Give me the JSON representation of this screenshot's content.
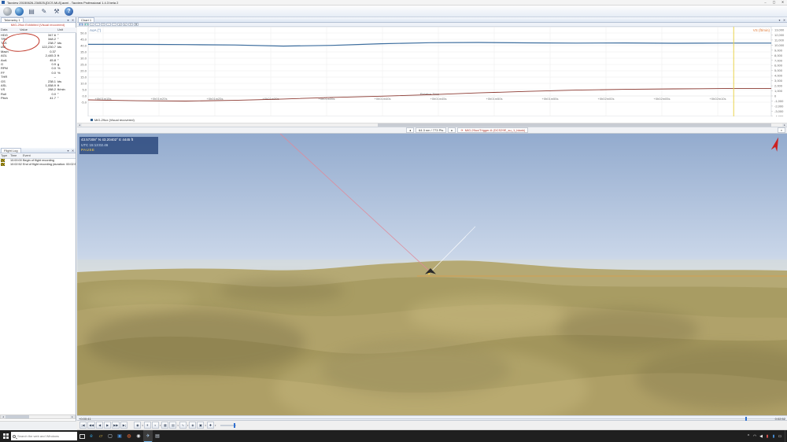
{
  "window": {
    "title": "Tacview 20150626-234525-[DCS.Mi-8].acmi - Tacview Professional 1.4.3 beta 2",
    "minimize": "–",
    "maximize": "▢",
    "close": "✕"
  },
  "panel_icons": {
    "pin": "▾",
    "close": "✕"
  },
  "toolbar": {
    "buttons": [
      {
        "name": "open-flight-button",
        "style": "globe-gray",
        "glyph": ""
      },
      {
        "name": "online-flight-button",
        "style": "globe-blue",
        "glyph": ""
      },
      {
        "name": "layout-button",
        "style": "",
        "glyph": "▤"
      },
      {
        "name": "edit-flight-button",
        "style": "",
        "glyph": "✎"
      },
      {
        "name": "tools-button",
        "style": "",
        "glyph": "⚒"
      },
      {
        "name": "help-button",
        "style": "help",
        "glyph": "?"
      }
    ]
  },
  "telemetry": {
    "tab": "Telemetry 1",
    "aircraft": "MiG-29ux Exhibited (Visual recovered)",
    "columns": [
      "Data",
      "Value",
      "Unit"
    ],
    "rows": [
      [
        "HDG",
        "347.6",
        "°"
      ],
      [
        "TRK",
        "348.2",
        "°"
      ],
      [
        "TAS",
        "238.7",
        "kts"
      ],
      [
        "IAS",
        "122,230.7",
        "kts"
      ],
      [
        "Mach",
        "0.37",
        ""
      ],
      [
        "AGL",
        "2,445.3",
        "ft"
      ],
      [
        "AoA",
        "45.8",
        "°"
      ],
      [
        "G",
        "0.9",
        "g"
      ],
      [
        "RPM",
        "0.0",
        "%"
      ],
      [
        "FF",
        "0.0",
        "%"
      ],
      [
        "THR",
        "–",
        ""
      ],
      [
        "GS",
        "238.1",
        "kts"
      ],
      [
        "ASL",
        "1,058.9",
        "ft"
      ],
      [
        "VS",
        "288.2",
        "ft/min"
      ],
      [
        "Roll",
        "0.0",
        "°"
      ],
      [
        "Pitch",
        "41.7",
        "°"
      ]
    ]
  },
  "flight_log": {
    "tab": "Flight Log",
    "columns": [
      "Type",
      "Time",
      "Event"
    ],
    "rows": [
      {
        "time": "10:00:00",
        "event": "Begin of flight recording"
      },
      {
        "time": "10:02:52",
        "event": "End of flight recording (duration: 00:02:52)"
      }
    ]
  },
  "chart": {
    "tab": "Chart 1",
    "mini_buttons": [
      {
        "name": "series-1-color",
        "glyph": "▦",
        "bg": "#5b8dd9"
      },
      {
        "name": "series-2-color",
        "glyph": "▦",
        "bg": "#4db6ac"
      },
      {
        "name": "zoom-in",
        "glyph": "+",
        "bg": ""
      },
      {
        "name": "zoom-out",
        "glyph": "−",
        "bg": ""
      },
      {
        "name": "fit-view",
        "glyph": "▭",
        "bg": ""
      },
      {
        "name": "pan-h",
        "glyph": "↔",
        "bg": ""
      },
      {
        "name": "pan-v",
        "glyph": "↕",
        "bg": ""
      },
      {
        "name": "prev",
        "glyph": "◂",
        "bg": ""
      },
      {
        "name": "next",
        "glyph": "▸",
        "bg": ""
      },
      {
        "name": "options",
        "glyph": "▾",
        "bg": ""
      },
      {
        "name": "add-series",
        "glyph": "✚",
        "bg": ""
      }
    ]
  },
  "chart_data": {
    "type": "line",
    "title": "Chart 1",
    "xlabel": "Relative Time",
    "x_ticks": [
      "+0h01m15s",
      "+0h01m20s",
      "+0h01m25s",
      "+0h01m30s",
      "+0h01m35s",
      "+0h01m40s",
      "+0h01m45s",
      "+0h01m50s",
      "+0h01m55s",
      "+0h02m00s",
      "+0h02m05s",
      "+0h02m10s"
    ],
    "left_axis": {
      "label": "AoA (°)",
      "color": "#5b7da8",
      "ticks": [
        50,
        45,
        40,
        35,
        30,
        25,
        20,
        15,
        10,
        5,
        0,
        -5
      ],
      "range": [
        -7.5,
        52.5
      ]
    },
    "right_axis": {
      "label": "VS (ft/min)",
      "color": "#e07b39",
      "ticks": [
        13000,
        12000,
        11000,
        10000,
        9000,
        8000,
        7000,
        6000,
        5000,
        4000,
        3000,
        2000,
        1000,
        0,
        -1000,
        -2000,
        -3000,
        -4000
      ],
      "range": [
        -4500,
        13300
      ]
    },
    "series": [
      {
        "name": "AoA",
        "axis": "left",
        "color": "#3c6d9e",
        "values": [
          41.0,
          41.0,
          40.8,
          40.5,
          39.6,
          40.2,
          41.5,
          42.3,
          42.5,
          42.2,
          42.0,
          42.1,
          41.9,
          42.0,
          42.0
        ]
      },
      {
        "name": "VS",
        "axis": "right",
        "color": "#8c3a32",
        "values": [
          -770,
          -950,
          -1000,
          -870,
          -600,
          -300,
          -50,
          250,
          600,
          900,
          1150,
          1300,
          1400,
          1450,
          1480
        ]
      }
    ],
    "legend": [
      {
        "label": "MiG-29ux (Visual recovered)",
        "color": "#2f5f8f"
      }
    ],
    "legend_position": "bottom-left",
    "grid": true,
    "cursor_x_fraction": 0.945,
    "cursor_color": "#e8d34f"
  },
  "status": {
    "nav_left": "◂",
    "distance_info": "64.3 nm / 773 Pts",
    "nav_right": "▸",
    "plane_icon": "✈",
    "selected_object": "MiG-29ux/Trigger-6 (DCS29E_su_1_blank)",
    "more": "»"
  },
  "view3d": {
    "overlay": {
      "position": "43.57308° N  43.20402° E   4445 ft",
      "utc": "UTC 15:13:02.46",
      "state": "PAUSE"
    }
  },
  "timeline": {
    "current": "+0:00:41",
    "total": "0:02:52"
  },
  "playback": {
    "transport": [
      {
        "name": "go-to-start-button",
        "glyph": "|◀"
      },
      {
        "name": "play-backward-fast-button",
        "glyph": "◀◀"
      },
      {
        "name": "play-backward-button",
        "glyph": "◀"
      },
      {
        "name": "play-button",
        "glyph": "▶"
      },
      {
        "name": "play-forward-fast-button",
        "glyph": "▶▶"
      },
      {
        "name": "go-to-end-button",
        "glyph": "▶|"
      }
    ],
    "tools": [
      {
        "name": "camera-mode-button",
        "glyph": "◉",
        "dd": true
      },
      {
        "name": "cockpit-view-button",
        "glyph": "✈",
        "dd": false
      },
      {
        "name": "external-view-button",
        "glyph": "◐",
        "dd": true
      },
      {
        "name": "map-mode-button",
        "glyph": "▦",
        "dd": false
      },
      {
        "name": "labels-toggle-button",
        "glyph": "▤",
        "dd": true
      },
      {
        "name": "trails-toggle-button",
        "glyph": "∿",
        "dd": true
      },
      {
        "name": "terrain-toggle-button",
        "glyph": "◈",
        "dd": false
      },
      {
        "name": "objects-filter-button",
        "glyph": "▣",
        "dd": true
      },
      {
        "name": "display-settings-button",
        "glyph": "✚",
        "dd": true
      }
    ]
  },
  "taskbar": {
    "search_placeholder": "Search the web and Windows",
    "apps": [
      {
        "name": "taskbar-app-edge",
        "glyph": "e",
        "color": "#35a5dd",
        "active": false
      },
      {
        "name": "taskbar-app-file-explorer",
        "glyph": "▱",
        "color": "#f2c94c",
        "active": false
      },
      {
        "name": "taskbar-app-store",
        "glyph": "▢",
        "color": "#d8e6f2",
        "active": false
      },
      {
        "name": "taskbar-app-photos",
        "glyph": "▣",
        "color": "#4a90d9",
        "active": false
      },
      {
        "name": "taskbar-app-firefox",
        "glyph": "◍",
        "color": "#ff7139",
        "active": false
      },
      {
        "name": "taskbar-app-chrome",
        "glyph": "◉",
        "color": "#e8eaed",
        "active": false
      },
      {
        "name": "taskbar-app-tacview",
        "glyph": "✈",
        "color": "#a9c9ea",
        "active": true
      },
      {
        "name": "taskbar-app-notepad",
        "glyph": "▤",
        "color": "#cfd8e3",
        "active": false
      }
    ],
    "tray": [
      {
        "name": "tray-expand-icon",
        "glyph": "^",
        "color": ""
      },
      {
        "name": "tray-network-icon",
        "glyph": "◠",
        "color": ""
      },
      {
        "name": "tray-volume-icon",
        "glyph": "◀",
        "color": ""
      },
      {
        "name": "tray-app-red-icon",
        "glyph": "▮",
        "color": "#d9534f"
      },
      {
        "name": "tray-app-blue-icon",
        "glyph": "▮",
        "color": "#4a90d9"
      },
      {
        "name": "action-center-icon",
        "glyph": "▭",
        "color": ""
      }
    ]
  }
}
